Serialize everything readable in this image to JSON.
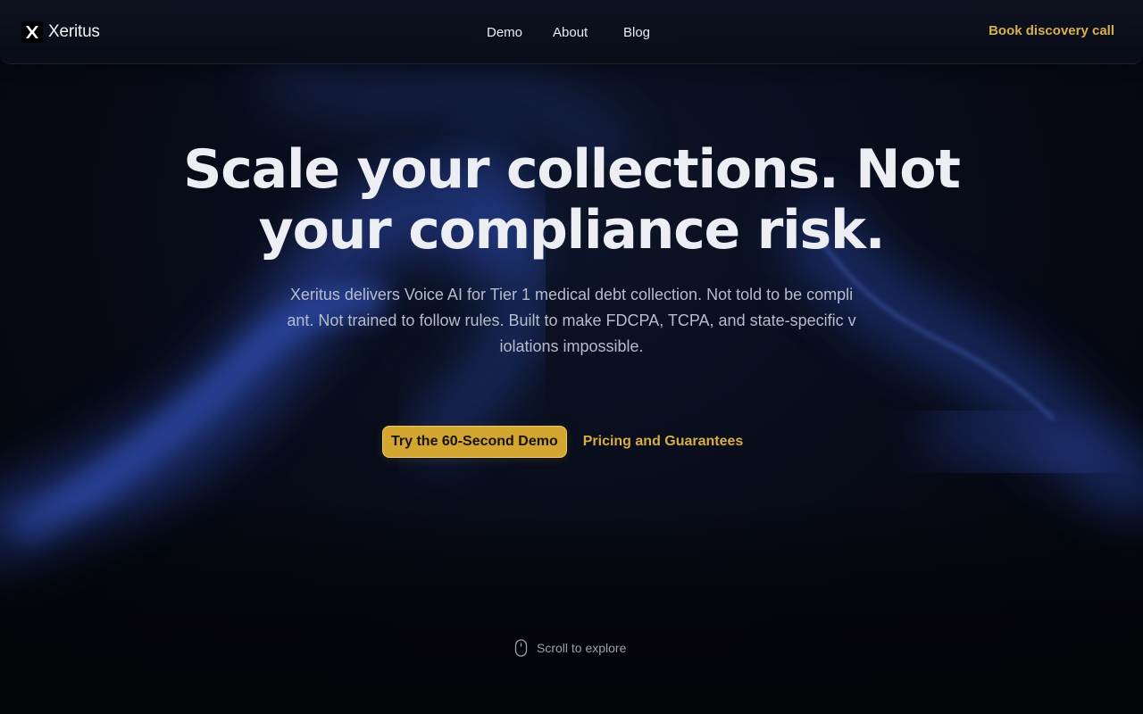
{
  "brand": {
    "name": "Xeritus",
    "logo_icon": "x-logo-icon"
  },
  "nav": {
    "links": [
      {
        "label": "Demo"
      },
      {
        "label": "About"
      },
      {
        "label": "Blog"
      }
    ],
    "cta_label": "Book discovery call"
  },
  "hero": {
    "title_line1": "Scale your collections. Not",
    "title_line2": "your compliance risk.",
    "subtitle": "Xeritus delivers Voice AI for Tier 1 medical debt collection. Not told to be compliant. Not trained to follow rules. Built to make FDCPA, TCPA, and state-specific violations impossible.",
    "primary_button": "Try the 60-Second Demo",
    "secondary_link": "Pricing and Guarantees"
  },
  "scroll_hint": {
    "label": "Scroll to explore",
    "icon": "mouse-icon"
  },
  "colors": {
    "accent_gold": "#d3a632",
    "gold_text": "#d9b14a",
    "background": "#070a16",
    "wave_blue": "#2f4fb8"
  }
}
